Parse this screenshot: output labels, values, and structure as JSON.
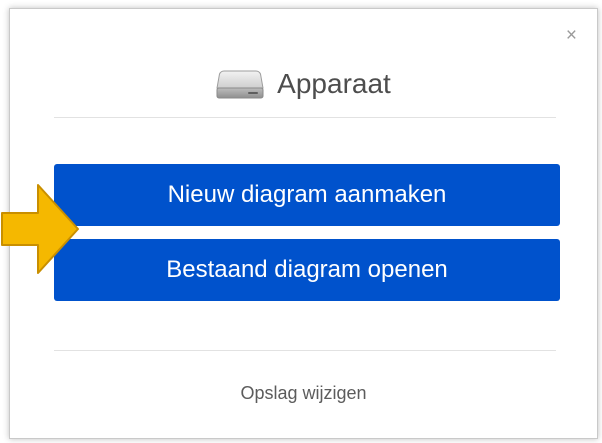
{
  "dialog": {
    "close_symbol": "×",
    "title": "Apparaat",
    "title_icon": "hard-drive-icon",
    "buttons": {
      "create_new": "Nieuw diagram aanmaken",
      "open_existing": "Bestaand diagram openen"
    },
    "change_storage": "Opslag wijzigen"
  },
  "annotation": {
    "arrow_icon": "pointer-arrow-icon",
    "arrow_color": "#f5b800"
  },
  "colors": {
    "button_bg": "#0052cc",
    "title_text": "#4d4d4d"
  }
}
